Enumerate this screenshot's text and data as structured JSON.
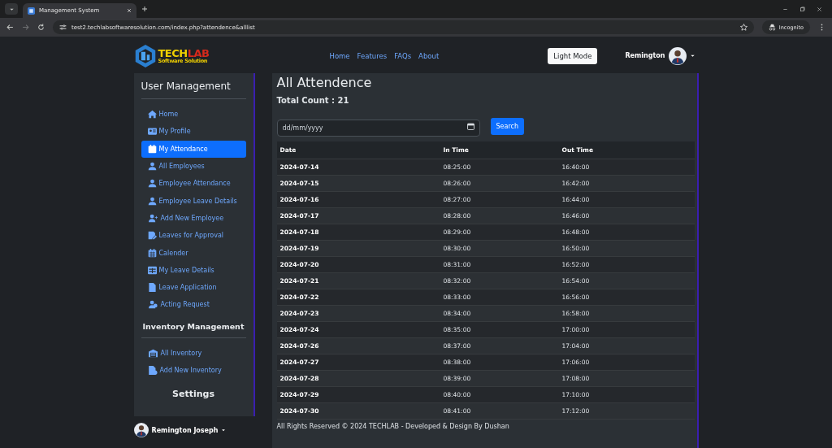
{
  "browser": {
    "tab_title": "Management System",
    "url": "test2.techlabsoftwaresolution.com/index.php?attendence&alllist",
    "profile_label": "Incognito"
  },
  "navbar": {
    "logo": {
      "part_1": "TECH",
      "part_2": "LAB",
      "tagline": "Software Solution"
    },
    "links": [
      "Home",
      "Features",
      "FAQs",
      "About"
    ],
    "theme_button": "Light Mode",
    "user_name": "Remington"
  },
  "sidebar": {
    "sections": [
      {
        "title": "User Management",
        "items": [
          {
            "label": "Home",
            "selected": false
          },
          {
            "label": "My Profile",
            "selected": false
          },
          {
            "label": "My Attendance",
            "selected": true
          },
          {
            "label": "All Employees",
            "selected": false
          },
          {
            "label": "Employee Attendance",
            "selected": false
          },
          {
            "label": "Employee Leave Details",
            "selected": false
          },
          {
            "label": "Add New Employee",
            "selected": false
          },
          {
            "label": "Leaves for Approval",
            "selected": false
          },
          {
            "label": "Calender",
            "selected": false
          },
          {
            "label": "My Leave Details",
            "selected": false
          },
          {
            "label": "Leave Application",
            "selected": false
          },
          {
            "label": "Acting Request",
            "selected": false
          }
        ]
      },
      {
        "title": "Inventory Management",
        "items": [
          {
            "label": "All Inventory",
            "selected": false
          },
          {
            "label": "Add New Inventory",
            "selected": false
          }
        ]
      },
      {
        "title": "Settings"
      }
    ],
    "user_name": "Remington Joseph"
  },
  "main": {
    "title": "All Attendence",
    "total_count": "Total Count : 21",
    "date_filter": {
      "placeholder": "dd/mm/yyyy"
    },
    "search_button": "Search",
    "table": {
      "columns": [
        "Date",
        "In Time",
        "Out Time"
      ],
      "rows": [
        [
          "2024-07-14",
          "08:25:00",
          "16:40:00"
        ],
        [
          "2024-07-15",
          "08:26:00",
          "16:42:00"
        ],
        [
          "2024-07-16",
          "08:27:00",
          "16:44:00"
        ],
        [
          "2024-07-17",
          "08:28:00",
          "16:46:00"
        ],
        [
          "2024-07-18",
          "08:29:00",
          "16:48:00"
        ],
        [
          "2024-07-19",
          "08:30:00",
          "16:50:00"
        ],
        [
          "2024-07-20",
          "08:31:00",
          "16:52:00"
        ],
        [
          "2024-07-21",
          "08:32:00",
          "16:54:00"
        ],
        [
          "2024-07-22",
          "08:33:00",
          "16:56:00"
        ],
        [
          "2024-07-23",
          "08:34:00",
          "16:58:00"
        ],
        [
          "2024-07-24",
          "08:35:00",
          "17:00:00"
        ],
        [
          "2024-07-26",
          "08:37:00",
          "17:04:00"
        ],
        [
          "2024-07-27",
          "08:38:00",
          "17:06:00"
        ],
        [
          "2024-07-28",
          "08:39:00",
          "17:08:00"
        ],
        [
          "2024-07-29",
          "08:40:00",
          "17:10:00"
        ],
        [
          "2024-07-30",
          "08:41:00",
          "17:12:00"
        ]
      ]
    }
  },
  "footer": "All Rights Reserved © 2024 TECHLAB - Developed & Design By Dushan"
}
